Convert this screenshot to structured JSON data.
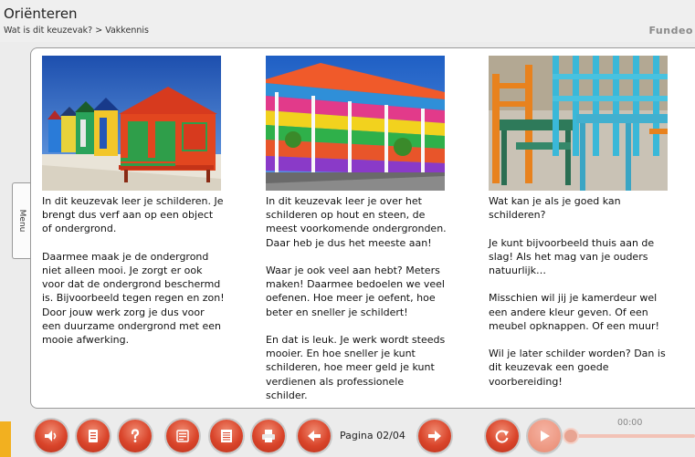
{
  "header": {
    "title": "Oriënteren",
    "breadcrumb": "Wat is dit keuzevak? > Vakkennis",
    "brand": "Fundeo"
  },
  "menu_tab": {
    "label": "Menu"
  },
  "columns": [
    {
      "paragraphs": [
        "In dit keuzevak leer je schilderen. Je brengt dus verf aan op een object of ondergrond.",
        "Daarmee maak je de ondergrond niet alleen mooi. Je zorgt er ook voor dat de ondergrond beschermd is. Bijvoorbeeld tegen regen en zon! Door jouw werk zorg je dus voor een duurzame ondergrond met een mooie afwerking."
      ]
    },
    {
      "paragraphs": [
        "In dit keuzevak leer je over het schilderen op hout en steen, de meest voorkomende ondergronden. Daar heb je dus het meeste aan!",
        "Waar je ook veel aan hebt? Meters maken! Daarmee bedoelen we veel oefenen. Hoe meer je oefent, hoe beter en sneller je schildert!",
        "En dat is leuk. Je werk wordt steeds mooier. En hoe sneller je kunt schilderen, hoe meer geld je kunt verdienen als professionele schilder."
      ]
    },
    {
      "paragraphs": [
        "Wat kan je als je goed kan schilderen?",
        "Je kunt bijvoorbeeld thuis aan de slag! Als het mag van je ouders natuurlijk…",
        "Misschien wil jij je kamerdeur wel een andere kleur geven. Of een meubel opknappen. Of een muur!",
        "Wil je later schilder worden? Dan is dit keuzevak een goede voorbereiding!"
      ]
    }
  ],
  "footer": {
    "page_label": "Pagina 02/04",
    "time": "00:00",
    "audio_progress": 0.0,
    "button_color": "#d9442a",
    "buttons": [
      {
        "name": "audio-button",
        "icon": "speaker-icon"
      },
      {
        "name": "document-button",
        "icon": "document-icon"
      },
      {
        "name": "help-button",
        "icon": "question-icon"
      },
      {
        "name": "text-button",
        "icon": "text-lines-icon"
      },
      {
        "name": "notes-button",
        "icon": "notes-icon"
      },
      {
        "name": "print-button",
        "icon": "printer-icon"
      },
      {
        "name": "previous-page-button",
        "icon": "arrow-left-icon"
      },
      {
        "name": "next-page-button",
        "icon": "arrow-right-icon"
      },
      {
        "name": "replay-button",
        "icon": "replay-icon"
      },
      {
        "name": "play-button",
        "icon": "play-icon"
      }
    ]
  }
}
